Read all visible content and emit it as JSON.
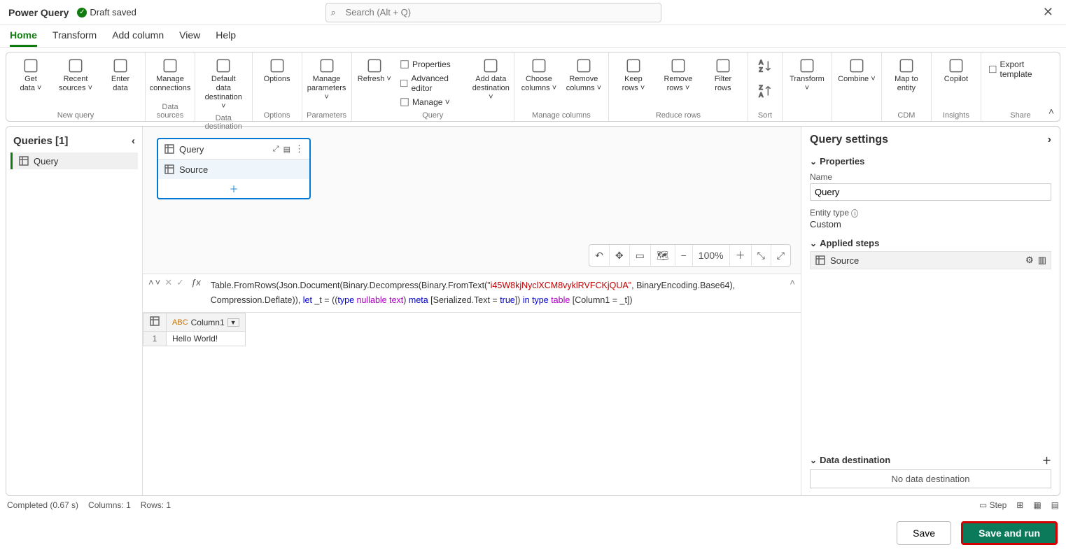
{
  "app_title": "Power Query",
  "save_status": "Draft saved",
  "search_placeholder": "Search (Alt + Q)",
  "tabs": [
    "Home",
    "Transform",
    "Add column",
    "View",
    "Help"
  ],
  "active_tab": "Home",
  "ribbon": {
    "groups": [
      {
        "label": "New query",
        "buttons": [
          {
            "t": "Get\ndata",
            "dd": true
          },
          {
            "t": "Recent\nsources",
            "dd": true
          },
          {
            "t": "Enter\ndata"
          }
        ]
      },
      {
        "label": "Data sources",
        "buttons": [
          {
            "t": "Manage\nconnections"
          }
        ]
      },
      {
        "label": "Data destination",
        "buttons": [
          {
            "t": "Default data\ndestination",
            "dd": true
          }
        ]
      },
      {
        "label": "Options",
        "buttons": [
          {
            "t": "Options"
          }
        ]
      },
      {
        "label": "Parameters",
        "buttons": [
          {
            "t": "Manage\nparameters",
            "dd": true
          }
        ]
      },
      {
        "label": "Query",
        "buttons": [
          {
            "t": "Refresh",
            "dd": true
          }
        ],
        "mini": [
          "Properties",
          "Advanced editor",
          "Manage"
        ],
        "extra": [
          {
            "t": "Add data\ndestination",
            "dd": true
          }
        ]
      },
      {
        "label": "Manage columns",
        "buttons": [
          {
            "t": "Choose\ncolumns",
            "dd": true
          },
          {
            "t": "Remove\ncolumns",
            "dd": true
          }
        ]
      },
      {
        "label": "Reduce rows",
        "buttons": [
          {
            "t": "Keep\nrows",
            "dd": true
          },
          {
            "t": "Remove\nrows",
            "dd": true
          },
          {
            "t": "Filter\nrows"
          }
        ]
      },
      {
        "label": "Sort",
        "sort": true
      },
      {
        "label": "",
        "buttons": [
          {
            "t": "Transform",
            "dd": true
          }
        ]
      },
      {
        "label": "",
        "buttons": [
          {
            "t": "Combine",
            "dd": true
          }
        ]
      },
      {
        "label": "CDM",
        "buttons": [
          {
            "t": "Map to\nentity"
          }
        ]
      },
      {
        "label": "Insights",
        "buttons": [
          {
            "t": "Copilot"
          }
        ]
      },
      {
        "label": "Share",
        "mini": [
          "Export template"
        ]
      }
    ]
  },
  "queries": {
    "header": "Queries [1]",
    "items": [
      "Query"
    ]
  },
  "diagram": {
    "card_title": "Query",
    "card_step": "Source",
    "zoom": "100%"
  },
  "formula_tokens": [
    {
      "t": "Table.FromRows(Json.Document(Binary.Decompress(Binary.FromText("
    },
    {
      "t": "\"i45W8kjNyclXCM8vyklRVFCKjQUA\"",
      "c": "str"
    },
    {
      "t": ", BinaryEncoding.Base64), Compression.Deflate)), "
    },
    {
      "t": "let",
      "c": "kw"
    },
    {
      "t": " _t = (("
    },
    {
      "t": "type",
      "c": "kw"
    },
    {
      "t": " "
    },
    {
      "t": "nullable",
      "c": "np"
    },
    {
      "t": " "
    },
    {
      "t": "text",
      "c": "np"
    },
    {
      "t": ") "
    },
    {
      "t": "meta",
      "c": "kw"
    },
    {
      "t": " [Serialized.Text = "
    },
    {
      "t": "true",
      "c": "kw"
    },
    {
      "t": "]) "
    },
    {
      "t": "in",
      "c": "kw"
    },
    {
      "t": " "
    },
    {
      "t": "type",
      "c": "kw"
    },
    {
      "t": " "
    },
    {
      "t": "table",
      "c": "np"
    },
    {
      "t": " [Column1 = _t])"
    }
  ],
  "grid": {
    "column": "Column1",
    "rows": [
      {
        "n": "1",
        "v": "Hello World!"
      }
    ]
  },
  "settings": {
    "title": "Query settings",
    "properties": "Properties",
    "name_label": "Name",
    "name_value": "Query",
    "entity_type_label": "Entity type",
    "entity_type_value": "Custom",
    "applied_steps": "Applied steps",
    "step": "Source",
    "data_destination": "Data destination",
    "no_dest": "No data destination"
  },
  "statusbar": {
    "completed": "Completed (0.67 s)",
    "columns": "Columns: 1",
    "rows": "Rows: 1",
    "step": "Step"
  },
  "footer": {
    "save": "Save",
    "saverun": "Save and run"
  }
}
